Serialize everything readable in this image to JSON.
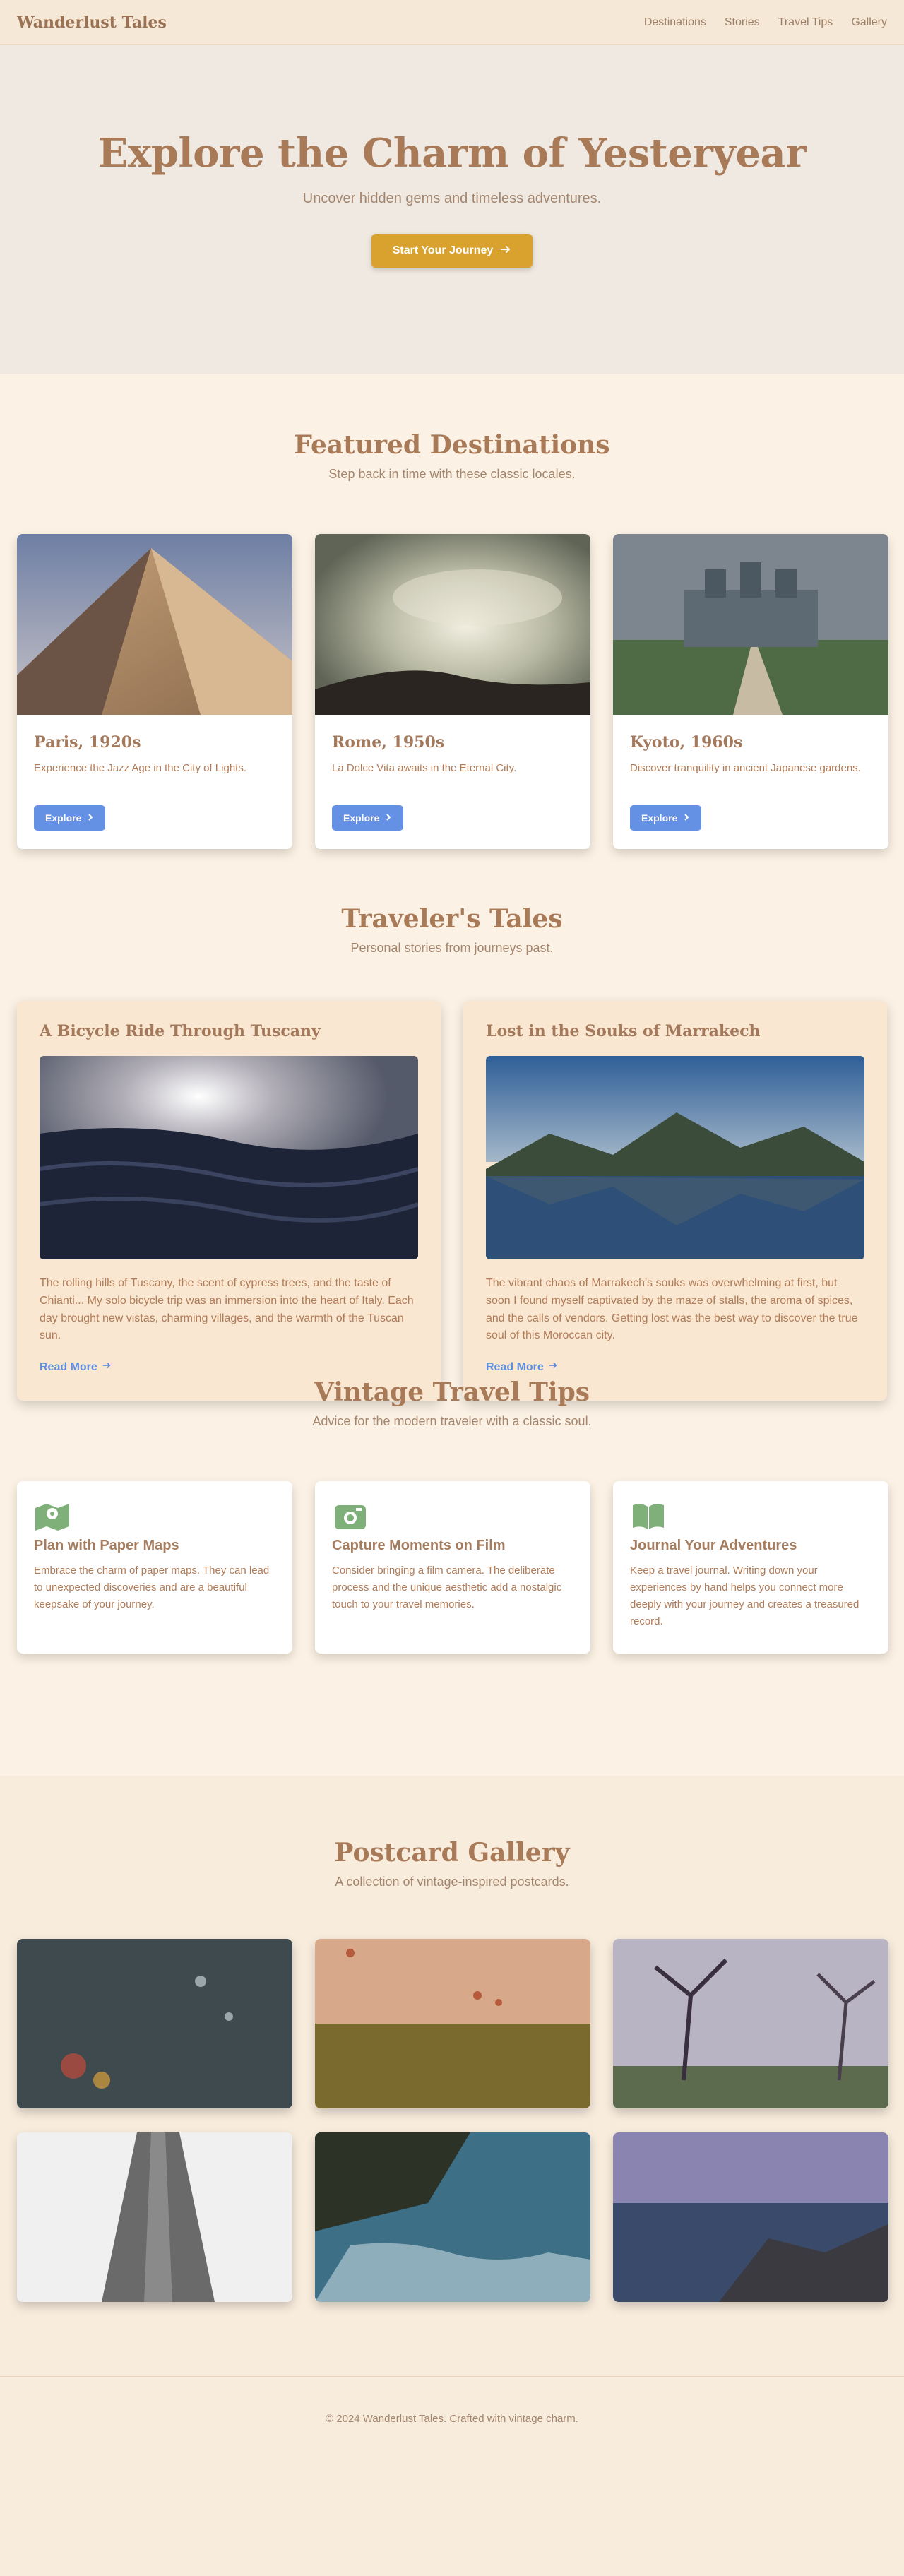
{
  "header": {
    "brand": "Wanderlust Tales",
    "nav": [
      "Destinations",
      "Stories",
      "Travel Tips",
      "Gallery"
    ]
  },
  "hero": {
    "title": "Explore the Charm of Yesteryear",
    "subtitle": "Uncover hidden gems and timeless adventures.",
    "cta": "Start Your Journey",
    "cta_icon": "arrow-right-icon",
    "cta_color": "#d9a22e"
  },
  "featured": {
    "title": "Featured Destinations",
    "subtitle": "Step back in time with these classic locales.",
    "cards": [
      {
        "title": "Paris, 1920s",
        "desc": "Experience the Jazz Age in the City of Lights.",
        "button": "Explore"
      },
      {
        "title": "Rome, 1950s",
        "desc": "La Dolce Vita awaits in the Eternal City.",
        "button": "Explore"
      },
      {
        "title": "Kyoto, 1960s",
        "desc": "Discover tranquility in ancient Japanese gardens.",
        "button": "Explore"
      }
    ]
  },
  "stories": {
    "title": "Traveler's Tales",
    "subtitle": "Personal stories from journeys past.",
    "cards": [
      {
        "title": "A Bicycle Ride Through Tuscany",
        "text": "The rolling hills of Tuscany, the scent of cypress trees, and the taste of Chianti... My solo bicycle trip was an immersion into the heart of Italy. Each day brought new vistas, charming villages, and the warmth of the Tuscan sun.",
        "link": "Read More"
      },
      {
        "title": "Lost in the Souks of Marrakech",
        "text": "The vibrant chaos of Marrakech's souks was overwhelming at first, but soon I found myself captivated by the maze of stalls, the aroma of spices, and the calls of vendors. Getting lost was the best way to discover the true soul of this Moroccan city.",
        "link": "Read More"
      }
    ]
  },
  "tips": {
    "title": "Vintage Travel Tips",
    "subtitle": "Advice for the modern traveler with a classic soul.",
    "cards": [
      {
        "icon": "map-pin-icon",
        "title": "Plan with Paper Maps",
        "desc": "Embrace the charm of paper maps. They can lead to unexpected discoveries and are a beautiful keepsake of your journey."
      },
      {
        "icon": "camera-icon",
        "title": "Capture Moments on Film",
        "desc": "Consider bringing a film camera. The deliberate process and the unique aesthetic add a nostalgic touch to your travel memories."
      },
      {
        "icon": "book-icon",
        "title": "Journal Your Adventures",
        "desc": "Keep a travel journal. Writing down your experiences by hand helps you connect more deeply with your journey and creates a treasured record."
      }
    ],
    "icon_color": "#7fb07a"
  },
  "gallery": {
    "title": "Postcard Gallery",
    "subtitle": "A collection of vintage-inspired postcards."
  },
  "footer": {
    "text": "© 2024 Wanderlust Tales. Crafted with vintage charm."
  }
}
